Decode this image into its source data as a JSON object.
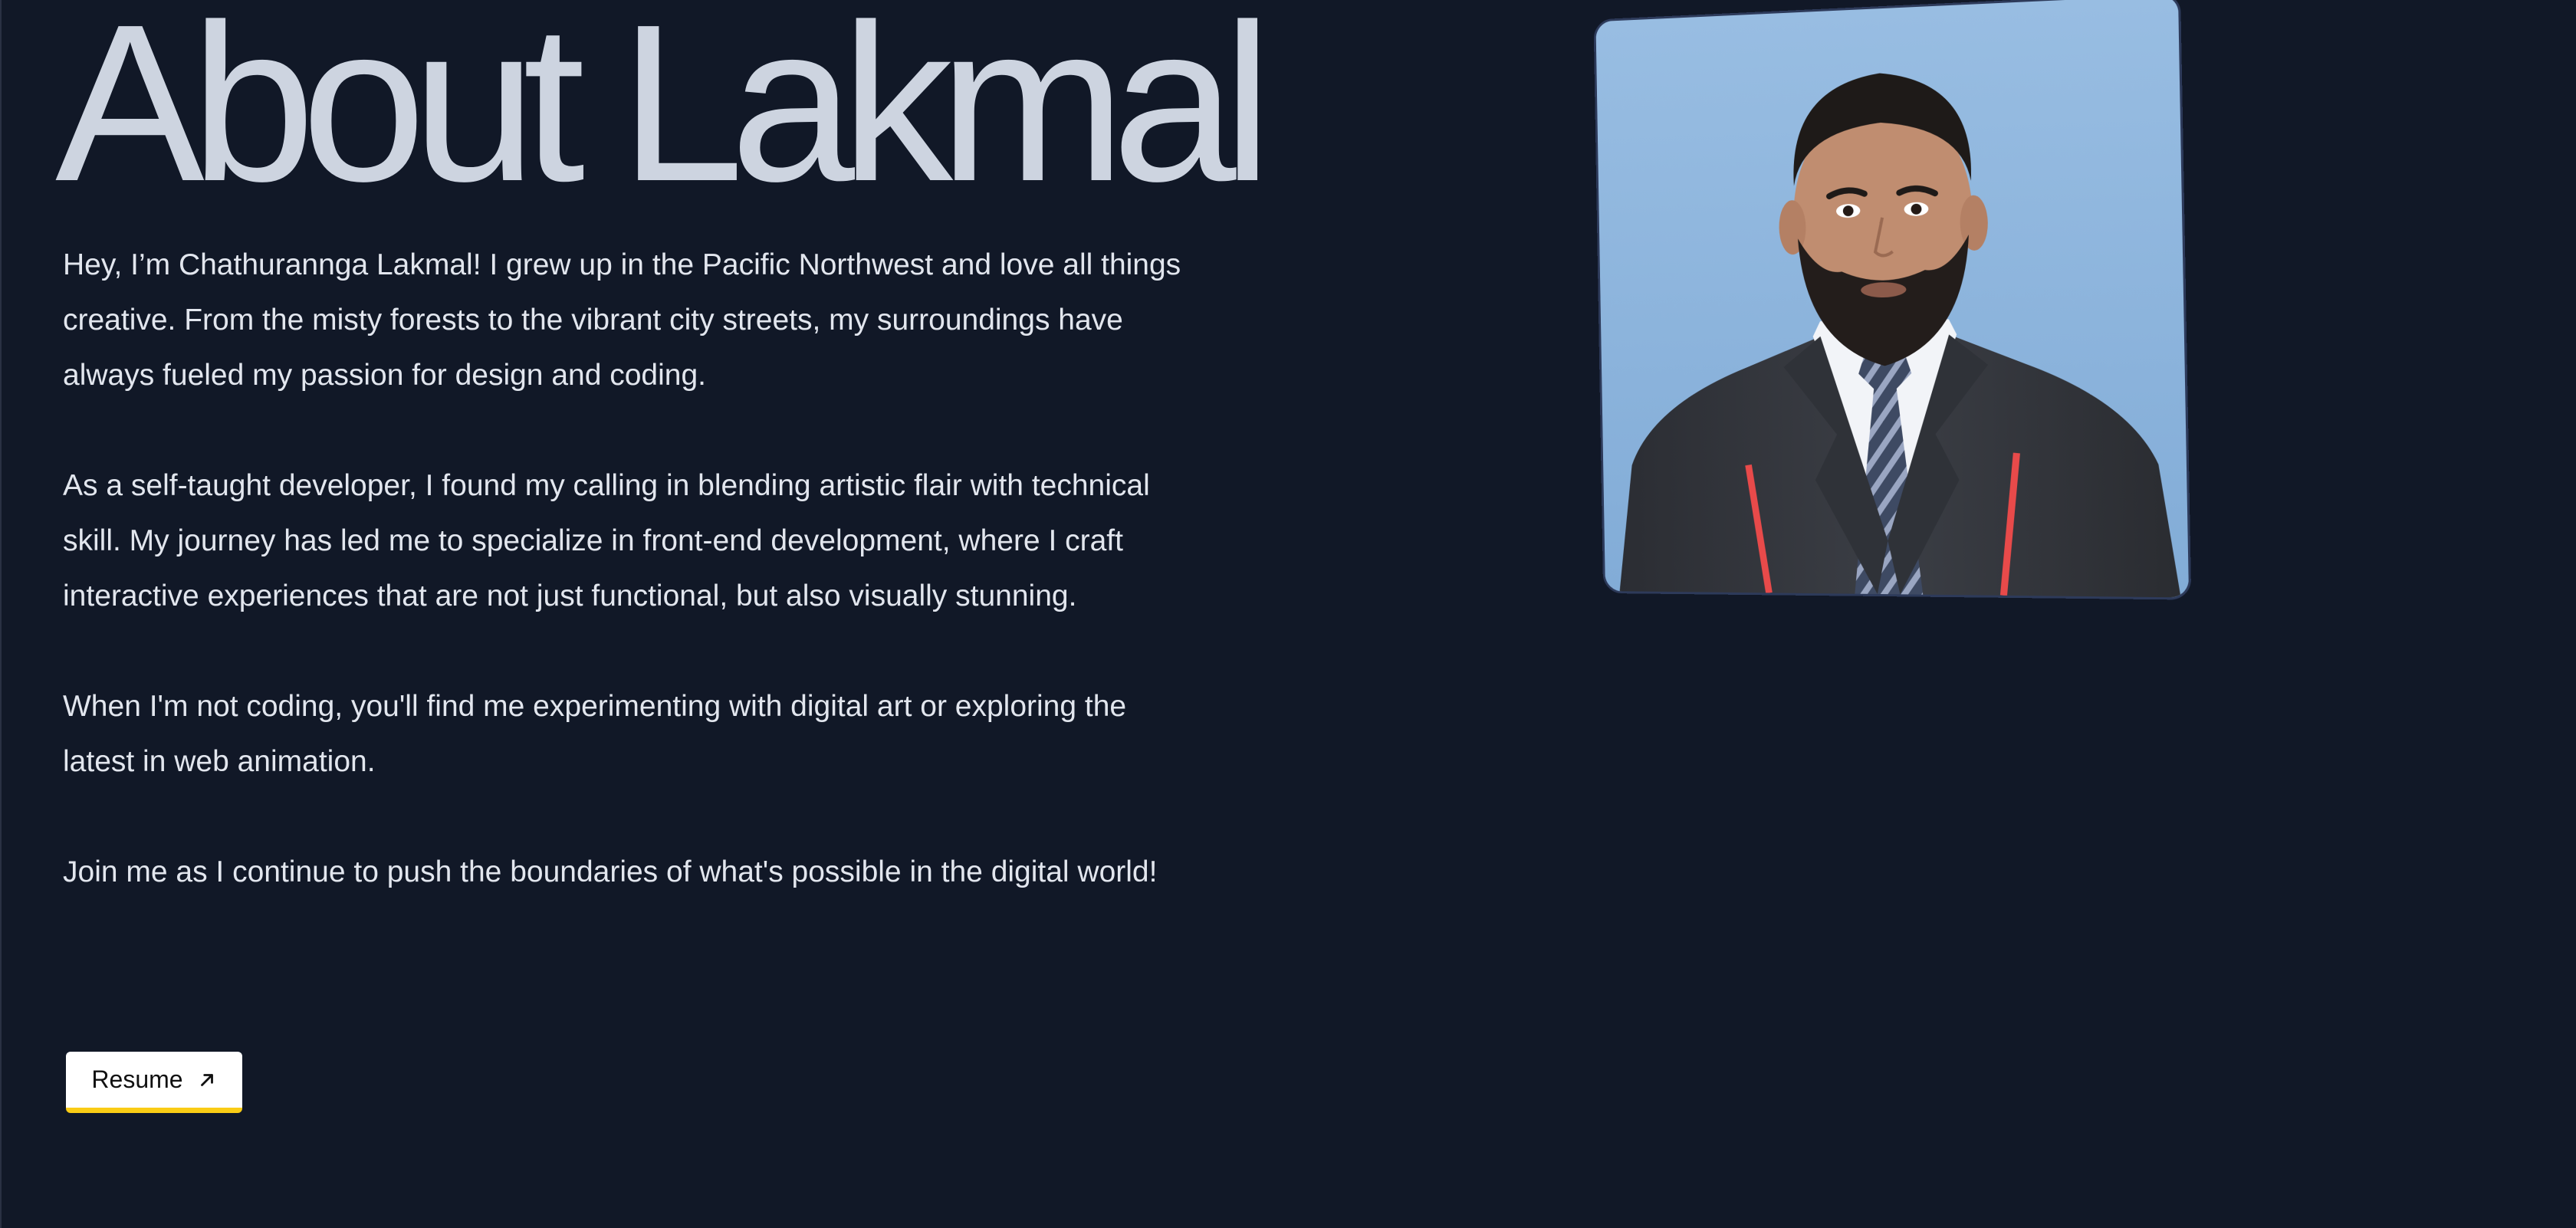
{
  "heading": "About Lakmal",
  "bio": {
    "paragraphs": [
      "Hey, I’m Chathurannga Lakmal! I grew up in the Pacific Northwest and love all things creative. From the misty forests to the vibrant city streets, my surroundings have always fueled my passion for design and coding.",
      "As a self-taught developer, I found my calling in blending artistic flair with technical skill. My journey has led me to specialize in front-end development, where I craft interactive experiences that are not just functional, but also visually stunning.",
      "When I'm not coding, you'll find me experimenting with digital art or exploring the latest in web animation.",
      "Join me as I continue to push the boundaries of what's possible in the digital world!"
    ]
  },
  "resume_button": {
    "label": "Resume",
    "icon": "arrow-up-right-icon"
  },
  "profile_photo": {
    "icon": "portrait-photo"
  },
  "colors": {
    "background": "#111827",
    "heading": "#cdd4e0",
    "body_text": "#e2e6ee",
    "button_bg": "#ffffff",
    "button_accent": "#facc15",
    "photo_background": "#8db4dc"
  }
}
